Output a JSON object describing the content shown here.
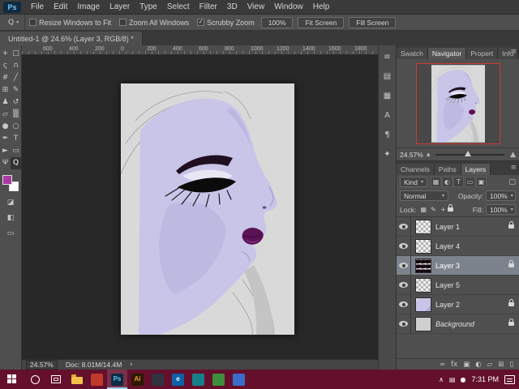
{
  "theme": {
    "face": "#c8c5e8",
    "face_shade": "#b1abd9",
    "lip": "#5c1256",
    "lip_accent": "#8e2f86",
    "page": "#d9d9d9",
    "canvas_bg": "#282828",
    "taskbar": "#64102c",
    "fg_swatch": "#a93aa0",
    "nav_border": "#cf3b2e",
    "selected_row": "#7d838c"
  },
  "menu_bar": {
    "logo": "Ps",
    "items": [
      "File",
      "Edit",
      "Image",
      "Layer",
      "Type",
      "Select",
      "Filter",
      "3D",
      "View",
      "Window",
      "Help"
    ]
  },
  "options_bar": {
    "tool_glyph": "Q",
    "dropdown_arrow": "▾",
    "check_glyph": "✓",
    "checkboxes": [
      {
        "label": "Resize Windows to Fit",
        "checked": false
      },
      {
        "label": "Zoom All Windows",
        "checked": false
      },
      {
        "label": "Scrubby Zoom",
        "checked": true
      }
    ],
    "buttons": [
      "100%",
      "Fit Screen",
      "Fill Screen"
    ]
  },
  "document_tab": {
    "title": "Untitled-1 @ 24.6% (Layer 3, RGB/8) *"
  },
  "toolbar": {
    "tools": [
      {
        "name": "move-tool",
        "glyph": "+"
      },
      {
        "name": "marquee-tool",
        "glyph": "□"
      },
      {
        "name": "lasso-tool",
        "glyph": "ς"
      },
      {
        "name": "quick-selection-tool",
        "glyph": "∩"
      },
      {
        "name": "crop-tool",
        "glyph": "#"
      },
      {
        "name": "eyedropper-tool",
        "glyph": "╱"
      },
      {
        "name": "healing-brush-tool",
        "glyph": "⊞"
      },
      {
        "name": "brush-tool",
        "glyph": "✎"
      },
      {
        "name": "clone-stamp-tool",
        "glyph": "♟"
      },
      {
        "name": "history-brush-tool",
        "glyph": "↺"
      },
      {
        "name": "eraser-tool",
        "glyph": "▱"
      },
      {
        "name": "gradient-tool",
        "glyph": "▒"
      },
      {
        "name": "blur-tool",
        "glyph": "●"
      },
      {
        "name": "dodge-tool",
        "glyph": "○"
      },
      {
        "name": "pen-tool",
        "glyph": "✒"
      },
      {
        "name": "type-tool",
        "glyph": "T"
      },
      {
        "name": "path-selection-tool",
        "glyph": "►"
      },
      {
        "name": "shape-tool",
        "glyph": "▭"
      },
      {
        "name": "hand-tool",
        "glyph": "Ψ"
      },
      {
        "name": "zoom-tool",
        "glyph": "Q",
        "selected": true
      }
    ],
    "extra_icons": [
      {
        "name": "default-colors-icon",
        "glyph": "◪"
      },
      {
        "name": "quick-mask-icon",
        "glyph": "◧"
      },
      {
        "name": "screen-mode-icon",
        "glyph": "▭"
      }
    ]
  },
  "ruler": {
    "labels": [
      "600",
      "400",
      "200",
      "0",
      "200",
      "400",
      "600",
      "800",
      "1000",
      "1200",
      "1400",
      "1600",
      "1800"
    ]
  },
  "status_bar": {
    "zoom": "24.57%",
    "doc": "Doc: 8.01M/14.4M",
    "chevron": "›"
  },
  "dock_strip": {
    "icons": [
      {
        "name": "dock-history-icon",
        "glyph": "≡"
      },
      {
        "name": "dock-styles-icon",
        "glyph": "▤"
      },
      {
        "name": "dock-swatches-icon",
        "glyph": "▦"
      },
      {
        "name": "dock-character-icon",
        "glyph": "A"
      },
      {
        "name": "dock-paragraph-icon",
        "glyph": "¶"
      },
      {
        "name": "dock-collapse-icon",
        "glyph": "✦"
      }
    ]
  },
  "panels": {
    "menu_glyph": "≡",
    "group1_tabs": [
      {
        "label": "Swatch",
        "active": false
      },
      {
        "label": "Navigator",
        "active": true
      },
      {
        "label": "Propert",
        "active": false
      },
      {
        "label": "Info",
        "active": false
      }
    ],
    "group2_tabs": [
      {
        "label": "Channels",
        "active": false
      },
      {
        "label": "Paths",
        "active": false
      },
      {
        "label": "Layers",
        "active": true
      }
    ]
  },
  "navigator": {
    "zoom": "24.57%",
    "mountain_small": "▲",
    "mountain_large": "▲"
  },
  "layers_panel": {
    "kind_label": "Kind",
    "filter_icons": [
      {
        "name": "filter-pixel-icon",
        "glyph": "▦"
      },
      {
        "name": "filter-adjustment-icon",
        "glyph": "◐"
      },
      {
        "name": "filter-type-icon",
        "glyph": "T"
      },
      {
        "name": "filter-shape-icon",
        "glyph": "▭"
      },
      {
        "name": "filter-smart-icon",
        "glyph": "▣"
      }
    ],
    "filter_toggle_glyph": "▢",
    "blend_mode": "Normal",
    "opacity_label": "Opacity:",
    "opacity_value": "100%",
    "lock_label": "Lock:",
    "lock_icons": [
      {
        "name": "lock-transparency-icon",
        "glyph": "▦"
      },
      {
        "name": "lock-paint-icon",
        "glyph": "✎"
      },
      {
        "name": "lock-position-icon",
        "glyph": "+"
      },
      {
        "name": "lock-all-icon",
        "glyph": "",
        "css_lock": true
      }
    ],
    "fill_label": "Fill:",
    "fill_value": "100%",
    "layers": [
      {
        "name": "Layer 1",
        "visible": true,
        "locked": true,
        "selected": false,
        "thumb": "checker"
      },
      {
        "name": "Layer 4",
        "visible": true,
        "locked": false,
        "selected": false,
        "thumb": "checker"
      },
      {
        "name": "Layer 3",
        "visible": true,
        "locked": true,
        "selected": true,
        "thumb": "checker-dark"
      },
      {
        "name": "Layer 5",
        "visible": true,
        "locked": false,
        "selected": false,
        "thumb": "checker"
      },
      {
        "name": "Layer 2",
        "visible": true,
        "locked": true,
        "selected": false,
        "thumb": "face"
      },
      {
        "name": "Background",
        "visible": true,
        "locked": true,
        "selected": false,
        "thumb": "solid",
        "italic": true
      }
    ],
    "bottom_icons": [
      {
        "name": "link-layers-icon",
        "glyph": "∞"
      },
      {
        "name": "layer-style-icon",
        "glyph": "fx"
      },
      {
        "name": "add-mask-icon",
        "glyph": "▣"
      },
      {
        "name": "adjustment-layer-icon",
        "glyph": "◐"
      },
      {
        "name": "new-group-icon",
        "glyph": "▱"
      },
      {
        "name": "new-layer-icon",
        "glyph": "⊞"
      },
      {
        "name": "delete-layer-icon",
        "glyph": "▯"
      }
    ]
  },
  "taskbar": {
    "time": "7:31 PM",
    "chevron": "∧",
    "apps": [
      {
        "name": "taskbar-file-explorer",
        "type": "folder"
      },
      {
        "name": "taskbar-app-red",
        "bg": "#c0392b",
        "glyph": ""
      },
      {
        "name": "taskbar-photoshop",
        "bg": "#0d2b45",
        "glyph": "Ps",
        "fg": "#63c2f2",
        "active": true
      },
      {
        "name": "taskbar-illustrator",
        "bg": "#2a1a00",
        "glyph": "Ai",
        "fg": "#ff9a2e"
      },
      {
        "name": "taskbar-app-dark",
        "bg": "#30343f",
        "glyph": ""
      },
      {
        "name": "taskbar-edge",
        "bg": "#0c63a8",
        "glyph": "e",
        "fg": "#ffffff"
      },
      {
        "name": "taskbar-app-teal",
        "bg": "#16808a",
        "glyph": ""
      },
      {
        "name": "taskbar-app-green",
        "bg": "#3d8f3d",
        "glyph": ""
      },
      {
        "name": "taskbar-app-blue",
        "bg": "#3c6cc9",
        "glyph": ""
      }
    ],
    "tray_icons": [
      {
        "name": "tray-network-icon",
        "glyph": "▤"
      },
      {
        "name": "tray-volume-icon",
        "glyph": "●"
      }
    ]
  }
}
